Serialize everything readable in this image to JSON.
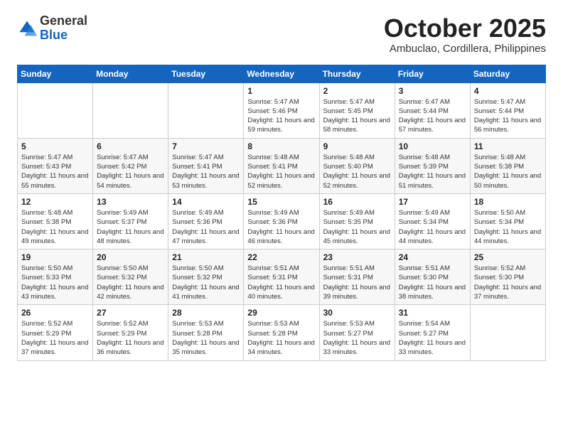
{
  "logo": {
    "general": "General",
    "blue": "Blue"
  },
  "title": "October 2025",
  "location": "Ambuclao, Cordillera, Philippines",
  "days_header": [
    "Sunday",
    "Monday",
    "Tuesday",
    "Wednesday",
    "Thursday",
    "Friday",
    "Saturday"
  ],
  "weeks": [
    [
      {
        "day": "",
        "info": ""
      },
      {
        "day": "",
        "info": ""
      },
      {
        "day": "",
        "info": ""
      },
      {
        "day": "1",
        "info": "Sunrise: 5:47 AM\nSunset: 5:46 PM\nDaylight: 11 hours\nand 59 minutes."
      },
      {
        "day": "2",
        "info": "Sunrise: 5:47 AM\nSunset: 5:45 PM\nDaylight: 11 hours\nand 58 minutes."
      },
      {
        "day": "3",
        "info": "Sunrise: 5:47 AM\nSunset: 5:44 PM\nDaylight: 11 hours\nand 57 minutes."
      },
      {
        "day": "4",
        "info": "Sunrise: 5:47 AM\nSunset: 5:44 PM\nDaylight: 11 hours\nand 56 minutes."
      }
    ],
    [
      {
        "day": "5",
        "info": "Sunrise: 5:47 AM\nSunset: 5:43 PM\nDaylight: 11 hours\nand 55 minutes."
      },
      {
        "day": "6",
        "info": "Sunrise: 5:47 AM\nSunset: 5:42 PM\nDaylight: 11 hours\nand 54 minutes."
      },
      {
        "day": "7",
        "info": "Sunrise: 5:47 AM\nSunset: 5:41 PM\nDaylight: 11 hours\nand 53 minutes."
      },
      {
        "day": "8",
        "info": "Sunrise: 5:48 AM\nSunset: 5:41 PM\nDaylight: 11 hours\nand 52 minutes."
      },
      {
        "day": "9",
        "info": "Sunrise: 5:48 AM\nSunset: 5:40 PM\nDaylight: 11 hours\nand 52 minutes."
      },
      {
        "day": "10",
        "info": "Sunrise: 5:48 AM\nSunset: 5:39 PM\nDaylight: 11 hours\nand 51 minutes."
      },
      {
        "day": "11",
        "info": "Sunrise: 5:48 AM\nSunset: 5:38 PM\nDaylight: 11 hours\nand 50 minutes."
      }
    ],
    [
      {
        "day": "12",
        "info": "Sunrise: 5:48 AM\nSunset: 5:38 PM\nDaylight: 11 hours\nand 49 minutes."
      },
      {
        "day": "13",
        "info": "Sunrise: 5:49 AM\nSunset: 5:37 PM\nDaylight: 11 hours\nand 48 minutes."
      },
      {
        "day": "14",
        "info": "Sunrise: 5:49 AM\nSunset: 5:36 PM\nDaylight: 11 hours\nand 47 minutes."
      },
      {
        "day": "15",
        "info": "Sunrise: 5:49 AM\nSunset: 5:36 PM\nDaylight: 11 hours\nand 46 minutes."
      },
      {
        "day": "16",
        "info": "Sunrise: 5:49 AM\nSunset: 5:35 PM\nDaylight: 11 hours\nand 45 minutes."
      },
      {
        "day": "17",
        "info": "Sunrise: 5:49 AM\nSunset: 5:34 PM\nDaylight: 11 hours\nand 44 minutes."
      },
      {
        "day": "18",
        "info": "Sunrise: 5:50 AM\nSunset: 5:34 PM\nDaylight: 11 hours\nand 44 minutes."
      }
    ],
    [
      {
        "day": "19",
        "info": "Sunrise: 5:50 AM\nSunset: 5:33 PM\nDaylight: 11 hours\nand 43 minutes."
      },
      {
        "day": "20",
        "info": "Sunrise: 5:50 AM\nSunset: 5:32 PM\nDaylight: 11 hours\nand 42 minutes."
      },
      {
        "day": "21",
        "info": "Sunrise: 5:50 AM\nSunset: 5:32 PM\nDaylight: 11 hours\nand 41 minutes."
      },
      {
        "day": "22",
        "info": "Sunrise: 5:51 AM\nSunset: 5:31 PM\nDaylight: 11 hours\nand 40 minutes."
      },
      {
        "day": "23",
        "info": "Sunrise: 5:51 AM\nSunset: 5:31 PM\nDaylight: 11 hours\nand 39 minutes."
      },
      {
        "day": "24",
        "info": "Sunrise: 5:51 AM\nSunset: 5:30 PM\nDaylight: 11 hours\nand 38 minutes."
      },
      {
        "day": "25",
        "info": "Sunrise: 5:52 AM\nSunset: 5:30 PM\nDaylight: 11 hours\nand 37 minutes."
      }
    ],
    [
      {
        "day": "26",
        "info": "Sunrise: 5:52 AM\nSunset: 5:29 PM\nDaylight: 11 hours\nand 37 minutes."
      },
      {
        "day": "27",
        "info": "Sunrise: 5:52 AM\nSunset: 5:29 PM\nDaylight: 11 hours\nand 36 minutes."
      },
      {
        "day": "28",
        "info": "Sunrise: 5:53 AM\nSunset: 5:28 PM\nDaylight: 11 hours\nand 35 minutes."
      },
      {
        "day": "29",
        "info": "Sunrise: 5:53 AM\nSunset: 5:28 PM\nDaylight: 11 hours\nand 34 minutes."
      },
      {
        "day": "30",
        "info": "Sunrise: 5:53 AM\nSunset: 5:27 PM\nDaylight: 11 hours\nand 33 minutes."
      },
      {
        "day": "31",
        "info": "Sunrise: 5:54 AM\nSunset: 5:27 PM\nDaylight: 11 hours\nand 33 minutes."
      },
      {
        "day": "",
        "info": ""
      }
    ]
  ]
}
